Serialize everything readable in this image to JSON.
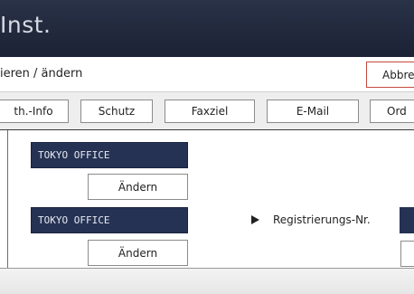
{
  "header": {
    "title": "Inst."
  },
  "toolbar": {
    "breadcrumb": "ieren / ändern",
    "abort_label": "Abbre"
  },
  "tabs": [
    {
      "label": "th.-Info"
    },
    {
      "label": "Schutz"
    },
    {
      "label": "Faxziel"
    },
    {
      "label": "E-Mail"
    },
    {
      "label": "Ord"
    }
  ],
  "entries": [
    {
      "name": "TOKYO OFFICE",
      "edit_label": "Ändern"
    },
    {
      "name": "TOKYO OFFICE",
      "edit_label": "Ändern"
    }
  ],
  "registration": {
    "label": "Registrierungs-Nr."
  },
  "colors": {
    "header_bg": "#1b2236",
    "name_field_bg": "#253253",
    "abort_border": "#c44a3f"
  }
}
